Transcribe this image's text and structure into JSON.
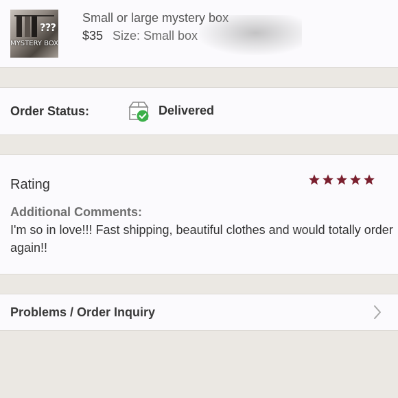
{
  "product": {
    "title": "Small or large mystery box",
    "price": "$35",
    "size": "Size: Small box",
    "thumbnail_label": "MYSTERY BOX",
    "thumbnail_marks": "???"
  },
  "order_status": {
    "label": "Order Status:",
    "value": "Delivered",
    "icon": "delivered-box-icon",
    "check_color": "#3cb04a"
  },
  "rating": {
    "title": "Rating",
    "stars": 5,
    "star_color": "#7a1f2e",
    "comments_label": "Additional Comments:",
    "comments_text": "I'm so in love!!! Fast shipping, beautiful clothes and would totally order again!!"
  },
  "problems": {
    "label": "Problems / Order Inquiry",
    "icon": "chevron-right-icon"
  }
}
